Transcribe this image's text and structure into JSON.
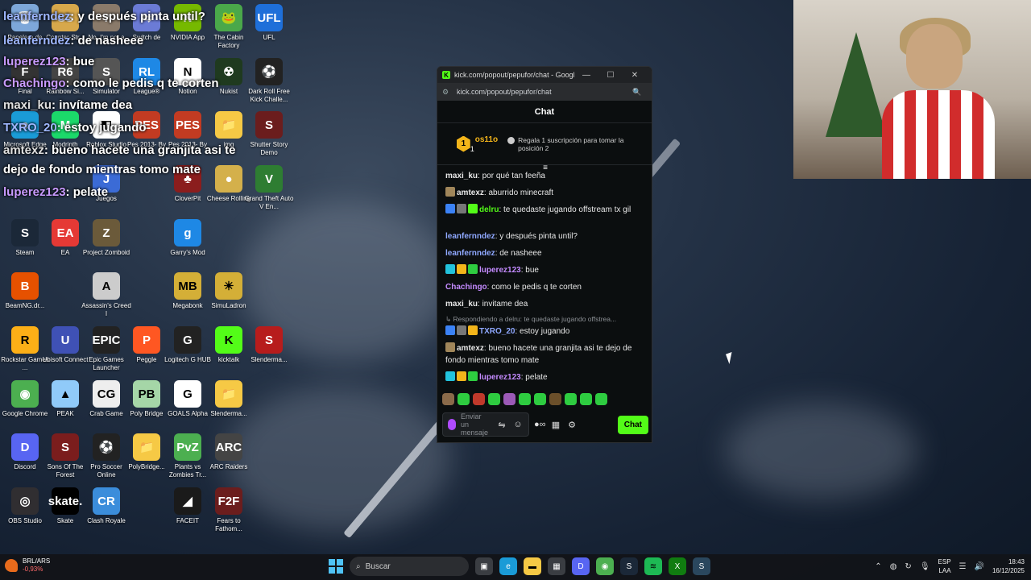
{
  "desktop": {
    "icons": [
      {
        "label": "Papelera de",
        "color": "#7da7d9",
        "glyph": "🗑"
      },
      {
        "label": "Counter-Str...",
        "color": "#d7a84b",
        "glyph": "CS"
      },
      {
        "label": "No, I'm not a",
        "color": "#8a7a6a",
        "glyph": "?"
      },
      {
        "label": "Switch de",
        "color": "#6b7bd6",
        "glyph": "⇆"
      },
      {
        "label": "NVIDIA App",
        "color": "#76b900",
        "glyph": "N"
      },
      {
        "label": "The Cabin Factory",
        "color": "#4aa84a",
        "glyph": "🐸"
      },
      {
        "label": "UFL",
        "color": "#1e6fd9",
        "glyph": "UFL"
      },
      {
        "label": "Final",
        "color": "#333",
        "glyph": "F"
      },
      {
        "label": "Rainbow Si...",
        "color": "#444",
        "glyph": "R6"
      },
      {
        "label": "Simulator",
        "color": "#555",
        "glyph": "S"
      },
      {
        "label": "League®",
        "color": "#1e88e5",
        "glyph": "RL"
      },
      {
        "label": "Notion",
        "color": "#ffffff",
        "glyph": "N"
      },
      {
        "label": "Nukist",
        "color": "#1f3a1f",
        "glyph": "☢"
      },
      {
        "label": "Dark Roll Free Kick Challe...",
        "color": "#222",
        "glyph": "⚽"
      },
      {
        "label": "Microsoft Edge",
        "color": "#1a9bd7",
        "glyph": "e"
      },
      {
        "label": "Modrinth",
        "color": "#1bd96a",
        "glyph": "M"
      },
      {
        "label": "Roblox Studio",
        "color": "#fff",
        "glyph": "◧"
      },
      {
        "label": "Pes 2013- By",
        "color": "#c23b22",
        "glyph": "PES"
      },
      {
        "label": "Pes 2013- By",
        "color": "#c23b22",
        "glyph": "PES"
      },
      {
        "label": "img",
        "color": "#f6c945",
        "glyph": "📁"
      },
      {
        "label": "Shutter Story Demo",
        "color": "#6b1d1d",
        "glyph": "S"
      },
      {
        "label": "Juegos",
        "color": "#3b6bd6",
        "glyph": "J"
      },
      {
        "label": "CloverPit",
        "color": "#8b1d1d",
        "glyph": "♣"
      },
      {
        "label": "Cheese Rolling",
        "color": "#d4b04b",
        "glyph": "●"
      },
      {
        "label": "Grand Theft Auto V En...",
        "color": "#2e7d32",
        "glyph": "V"
      },
      {
        "label": "Steam",
        "color": "#1b2838",
        "glyph": "S"
      },
      {
        "label": "EA",
        "color": "#e53935",
        "glyph": "EA"
      },
      {
        "label": "Project Zomboid",
        "color": "#6b5a3a",
        "glyph": "Z"
      },
      {
        "label": "Garry's Mod",
        "color": "#1e88e5",
        "glyph": "g"
      },
      {
        "label": "BeamNG.dr...",
        "color": "#e65100",
        "glyph": "B"
      },
      {
        "label": "Assassin's Creed I",
        "color": "#ccc",
        "glyph": "A"
      },
      {
        "label": "Megabonk",
        "color": "#d4af37",
        "glyph": "MB"
      },
      {
        "label": "SimuLadron",
        "color": "#d4af37",
        "glyph": "☀"
      },
      {
        "label": "Rockstar Games ...",
        "color": "#fcaf17",
        "glyph": "R"
      },
      {
        "label": "Ubisoft Connect",
        "color": "#3f51b5",
        "glyph": "U"
      },
      {
        "label": "Epic Games Launcher",
        "color": "#222",
        "glyph": "EPIC"
      },
      {
        "label": "Peggle",
        "color": "#ff5722",
        "glyph": "P"
      },
      {
        "label": "Logitech G HUB",
        "color": "#222",
        "glyph": "G"
      },
      {
        "label": "kicktalk",
        "color": "#53fc18",
        "glyph": "K"
      },
      {
        "label": "Slenderma...",
        "color": "#b71c1c",
        "glyph": "S"
      },
      {
        "label": "Google Chrome",
        "color": "#4caf50",
        "glyph": "◉"
      },
      {
        "label": "PEAK",
        "color": "#90caf9",
        "glyph": "▲"
      },
      {
        "label": "Crab Game",
        "color": "#eee",
        "glyph": "CG"
      },
      {
        "label": "Poly Bridge",
        "color": "#a5d6a7",
        "glyph": "PB"
      },
      {
        "label": "GOALS Alpha",
        "color": "#fff",
        "glyph": "G"
      },
      {
        "label": "Slenderma...",
        "color": "#f6c945",
        "glyph": "📁"
      },
      {
        "label": "Discord",
        "color": "#5865f2",
        "glyph": "D"
      },
      {
        "label": "Sons Of The Forest",
        "color": "#7b1d1d",
        "glyph": "S"
      },
      {
        "label": "Pro Soccer Online",
        "color": "#222",
        "glyph": "⚽"
      },
      {
        "label": "PolyBridge...",
        "color": "#f6c945",
        "glyph": "📁"
      },
      {
        "label": "Plants vs Zombies Tr...",
        "color": "#4caf50",
        "glyph": "PvZ"
      },
      {
        "label": "ARC Raiders",
        "color": "#444",
        "glyph": "ARC"
      },
      {
        "label": "OBS Studio",
        "color": "#302e31",
        "glyph": "◎"
      },
      {
        "label": "Skate",
        "color": "#000",
        "glyph": "skate."
      },
      {
        "label": "Clash Royale",
        "color": "#3b8ddb",
        "glyph": "CR"
      },
      {
        "label": "FACEIT",
        "color": "#1a1a1a",
        "glyph": "◢"
      },
      {
        "label": "Fears to Fathom...",
        "color": "#6b1d1d",
        "glyph": "F2F"
      }
    ],
    "overlay_chat": [
      {
        "user": "leanferndez",
        "text": ": y después pinta until?",
        "cls": "u"
      },
      {
        "user": "leanferndez",
        "text": ": de nasheee",
        "cls": "u"
      },
      {
        "user": "luperez123",
        "text": ": bue",
        "cls": "p"
      },
      {
        "user": "Chachingo",
        "text": ": como le pedis q te corten",
        "cls": "p"
      },
      {
        "user": "maxi_ku",
        "text": ": invítame dea",
        "cls": "g"
      },
      {
        "user": "TXRO_20",
        "text": ": estoy jugando",
        "cls": "u"
      },
      {
        "user": "amtexz",
        "text": ": bueno hacete una granjita asi te",
        "cls": "g"
      },
      {
        "user": "",
        "text": "dejo de fondo mientras tomo mate",
        "cls": "g"
      },
      {
        "user": "luperez123",
        "text": ": pelate",
        "cls": "p"
      }
    ]
  },
  "browser": {
    "title": "kick.com/popout/pepufor/chat - Google Ch...",
    "url": "kick.com/popout/pepufor/chat",
    "minimize": "—",
    "maximize": "☐",
    "close": "✕"
  },
  "chat": {
    "header": "Chat",
    "pinned": {
      "rank": "1",
      "user": "os11o",
      "count": "1",
      "message": "Regala 1 suscripción para tomar la posición 2"
    },
    "messages": [
      {
        "user": "maxi_ku",
        "user_color": "#e8e8e8",
        "text": ": por qué tan feeña",
        "badges": []
      },
      {
        "user": "amtexz",
        "user_color": "#e8e8e8",
        "text": ": aburrido minecraft",
        "badges": [
          "#a0865a"
        ]
      },
      {
        "user": "delru",
        "user_color": "#53fc18",
        "text": ": te quedaste jugando offstream tx gil",
        "badges": [
          "#3b82f6",
          "#777",
          "#53fc18"
        ]
      },
      {
        "user": "",
        "user_color": "#e8e8e8",
        "text": "",
        "badges": []
      },
      {
        "user": "leanfernndez",
        "user_color": "#8fa8ff",
        "text": ": y después pinta until?",
        "badges": []
      },
      {
        "user": "leanfernndez",
        "user_color": "#8fa8ff",
        "text": ": de nasheee",
        "badges": []
      },
      {
        "user": "luperez123",
        "user_color": "#c48bff",
        "text": ": bue",
        "badges": [
          "#22c3dd",
          "#f3b51a",
          "#2ecc40"
        ]
      },
      {
        "user": "Chachingo",
        "user_color": "#c48bff",
        "text": ": como le pedis q te corten",
        "badges": []
      },
      {
        "user": "maxi_ku",
        "user_color": "#e8e8e8",
        "text": ": invitame dea",
        "badges": []
      }
    ],
    "reply_label": "Respondiendo a delru: te quedaste jugando offstrea...",
    "reply_msg": {
      "user": "TXRO_20",
      "user_color": "#8fa8ff",
      "text": ": estoy jugando"
    },
    "messages2": [
      {
        "user": "amtexz",
        "user_color": "#e8e8e8",
        "text": ": bueno hacete una granjita asi te dejo de fondo mientras tomo mate"
      },
      {
        "user": "luperez123",
        "user_color": "#c48bff",
        "text": ": pelate"
      }
    ],
    "placeholder": "Enviar un mensaje",
    "send_label": "Chat"
  },
  "taskbar": {
    "currency": "BRL/ARS",
    "change": "-0,93%",
    "notif_count": "4",
    "search_placeholder": "Buscar",
    "lang": "ESP",
    "lang2": "LAA",
    "time": "18:43",
    "date": "16/12/2025"
  },
  "colors": {
    "kick_green": "#53fc18",
    "gold": "#f3b51a"
  }
}
